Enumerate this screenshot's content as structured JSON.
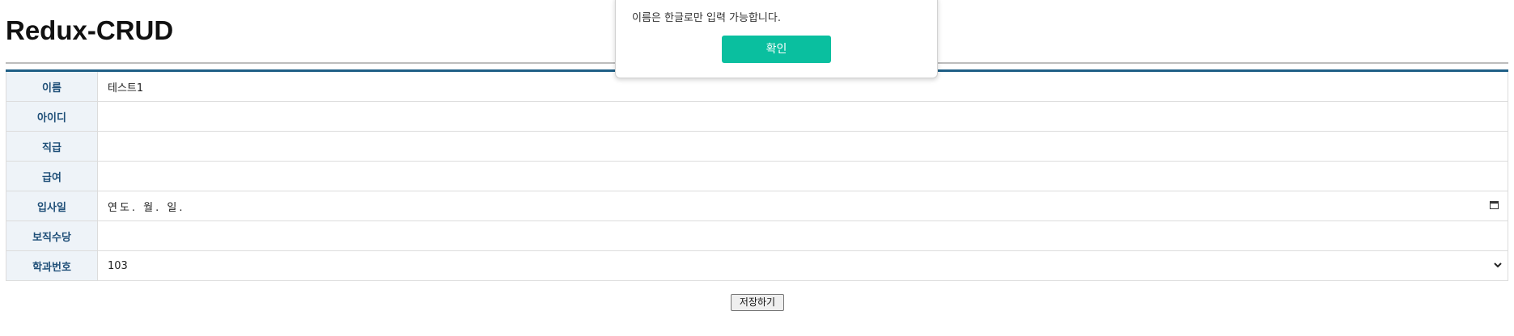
{
  "title": "Redux-CRUD",
  "form": {
    "rows": [
      {
        "label": "이름",
        "value": "테스트1"
      },
      {
        "label": "아이디",
        "value": ""
      },
      {
        "label": "직급",
        "value": ""
      },
      {
        "label": "급여",
        "value": ""
      },
      {
        "label": "입사일",
        "value": "연도. 월. 일."
      },
      {
        "label": "보직수당",
        "value": ""
      },
      {
        "label": "학과번호",
        "value": "103"
      }
    ]
  },
  "save_label": "저장하기",
  "dialog": {
    "message": "이름은 한글로만 입력 가능합니다.",
    "confirm_label": "확인"
  },
  "colors": {
    "accent": "#1f5f86",
    "confirm": "#0abf9f",
    "label_bg": "#eef3f8"
  }
}
